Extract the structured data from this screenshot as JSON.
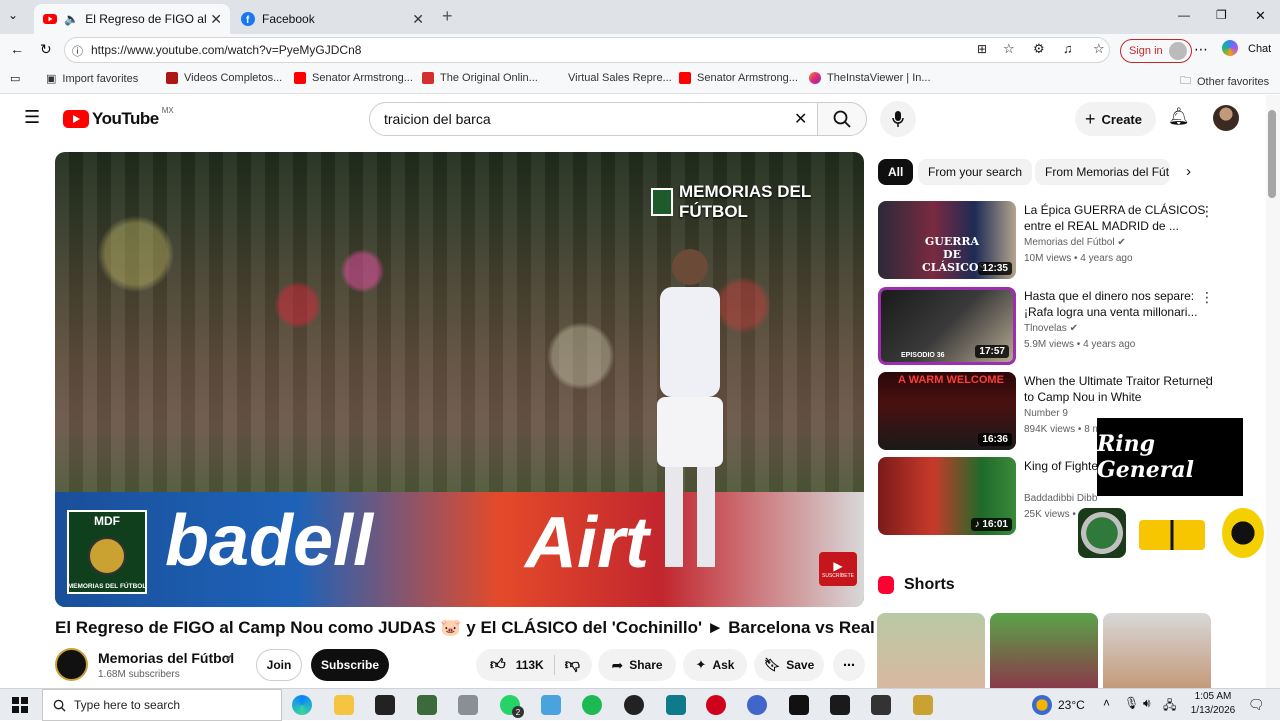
{
  "browser": {
    "tabs": [
      {
        "title": "El Regreso de FIGO al Camp N",
        "favicon": "youtube-icon"
      },
      {
        "title": "Facebook",
        "favicon": "facebook-icon"
      }
    ],
    "url": "https://www.youtube.com/watch?v=PyeMyGJDCn8",
    "signin_label": "Sign in",
    "chat_label": "Chat",
    "favorites": [
      "Import favorites",
      "Videos Completos...",
      "Senator Armstrong...",
      "The Original Onlin...",
      "Virtual Sales Repre...",
      "Senator Armstrong...",
      "TheInstaViewer | In..."
    ],
    "other_favorites": "Other favorites"
  },
  "youtube": {
    "logo_text": "YouTube",
    "region": "MX",
    "search_value": "traicion del barca",
    "create_label": "Create"
  },
  "video": {
    "watermark": "MEMORIAS DEL FÚTBOL",
    "badge_top": "MDF",
    "badge_bottom": "MEMORIAS DEL FÚTBOL",
    "subscribe_corner": "SUSCRÍBETE",
    "title": "El Regreso de FIGO al Camp Nou como JUDAS 🐷 y El CLÁSICO del 'Cochinillo' ► Barcelona vs Real Madrid",
    "channel": "Memorias del Fútbol",
    "subscribers": "1.68M subscribers",
    "join_label": "Join",
    "subscribe_label": "Subscribe",
    "likes": "113K",
    "share_label": "Share",
    "ask_label": "Ask",
    "save_label": "Save"
  },
  "chips": [
    "All",
    "From your search",
    "From Memorias del Fút"
  ],
  "recommendations": [
    {
      "title": "La Épica GUERRA de CLÁSICOS entre el REAL MADRID de ...",
      "channel": "Memorias del Fútbol",
      "verified": true,
      "meta": "10M views • 4 years ago",
      "duration": "12:35",
      "thumb_text": "GUERRA DE CLÁSICOS"
    },
    {
      "title": "Hasta que el dinero nos separe: ¡Rafa logra una venta millonari...",
      "channel": "Tlnovelas",
      "verified": true,
      "meta": "5.9M views • 4 years ago",
      "duration": "17:57",
      "thumb_text": "EPISODIO 36"
    },
    {
      "title": "When the Ultimate Traitor Returned to Camp Nou in White",
      "channel": "Number 9",
      "verified": false,
      "meta": "894K views • 8 m",
      "duration": "16:36",
      "thumb_text": "A WARM WELCOME"
    },
    {
      "title": "King of Fighte Soundtrack - S",
      "channel": "Baddadibbi Dibb",
      "verified": false,
      "meta": "25K views •",
      "duration": "16:01",
      "thumb_text": ""
    }
  ],
  "overlay": {
    "ring_general": "Ring General"
  },
  "shorts_label": "Shorts",
  "taskbar": {
    "search_placeholder": "Type here to search",
    "temperature": "23°C",
    "time": "1:05 AM",
    "date": "1/13/2026",
    "whatsapp_badge": "2"
  }
}
